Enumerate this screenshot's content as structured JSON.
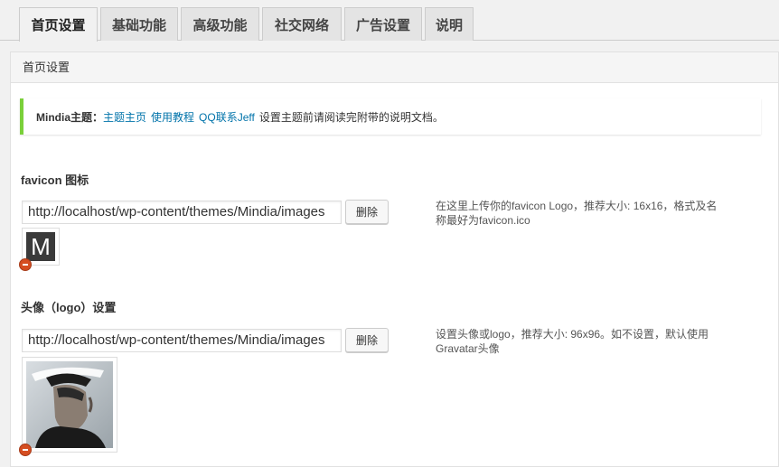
{
  "tabs": [
    {
      "label": "首页设置",
      "active": true
    },
    {
      "label": "基础功能",
      "active": false
    },
    {
      "label": "高级功能",
      "active": false
    },
    {
      "label": "社交网络",
      "active": false
    },
    {
      "label": "广告设置",
      "active": false
    },
    {
      "label": "说明",
      "active": false
    }
  ],
  "panel": {
    "title": "首页设置"
  },
  "notice": {
    "prefix": "Mindia主题：",
    "links": [
      "主题主页",
      "使用教程",
      "QQ联系Jeff"
    ],
    "text": "设置主题前请阅读完附带的说明文档。"
  },
  "favicon": {
    "label": "favicon 图标",
    "value": "http://localhost/wp-content/themes/Mindia/images",
    "delete_label": "删除",
    "description": "在这里上传你的favicon Logo，推荐大小: 16x16，格式及名称最好为favicon.ico",
    "preview_letter": "M"
  },
  "logo": {
    "label": "头像（logo）设置",
    "value": "http://localhost/wp-content/themes/Mindia/images",
    "delete_label": "删除",
    "description": "设置头像或logo，推荐大小: 96x96。如不设置，默认使用Gravatar头像"
  },
  "colors": {
    "notice_accent": "#7ad03a",
    "link": "#0073aa",
    "remove": "#d54e21"
  }
}
